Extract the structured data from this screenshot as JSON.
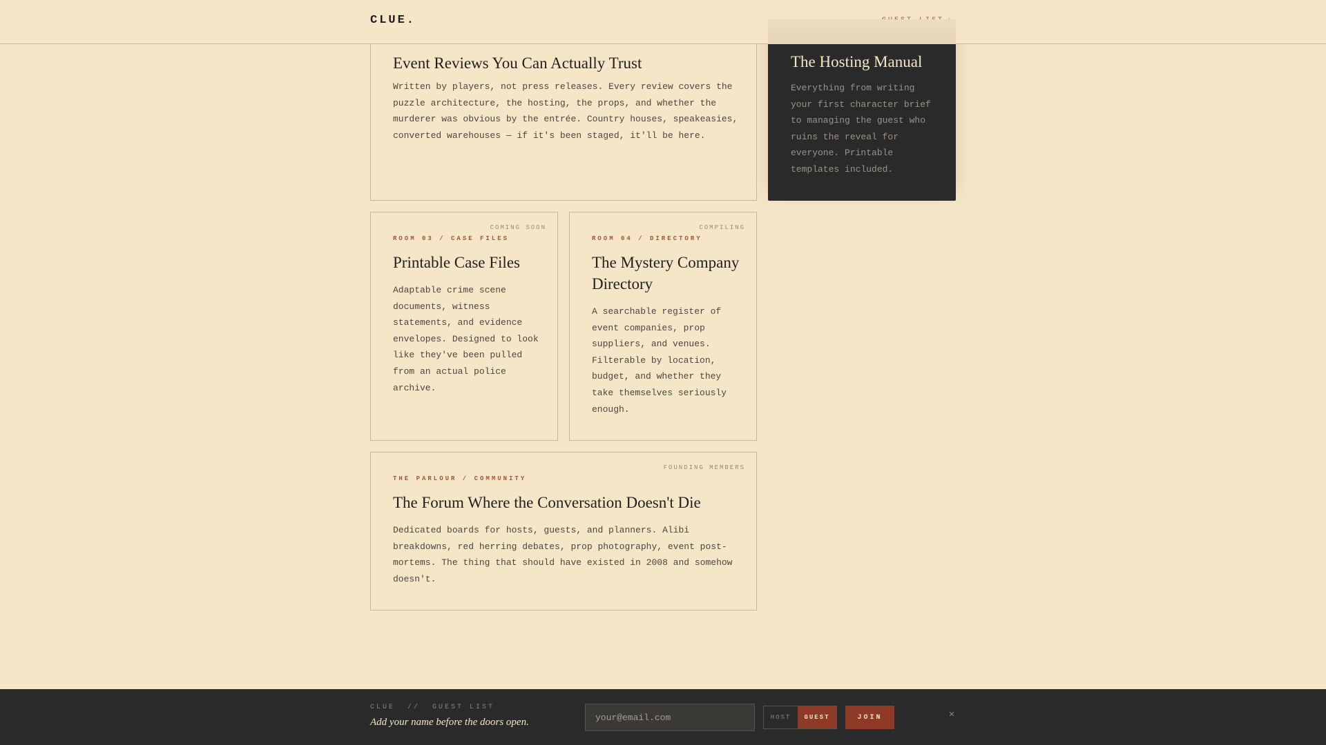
{
  "header": {
    "logo": "CLUE.",
    "guest_list_link": "GUEST LIST",
    "guest_list_arrow": "↓"
  },
  "cards": {
    "reviews": {
      "title": "Event Reviews You Can Actually Trust",
      "body": "Written by players, not press releases. Every review covers the puzzle architecture, the hosting, the props, and whether the murderer was obvious by the entrée. Country houses, speakeasies, converted warehouses — if it's been staged, it'll be here."
    },
    "hosting": {
      "title": "The Hosting Manual",
      "body": "Everything from writing your first character brief to managing the guest who ruins the reveal for everyone. Printable templates included."
    },
    "case_files": {
      "badge": "COMING SOON",
      "label": "ROOM 03 / CASE FILES",
      "title": "Printable Case Files",
      "body": "Adaptable crime scene documents, witness statements, and evidence envelopes. Designed to look like they've been pulled from an actual police archive."
    },
    "directory": {
      "badge": "COMPILING",
      "label": "ROOM 04 / DIRECTORY",
      "title": "The Mystery Company Directory",
      "body": "A searchable register of event companies, prop suppliers, and venues. Filterable by location, budget, and whether they take themselves seriously enough."
    },
    "forum": {
      "badge": "FOUNDING MEMBERS",
      "label": "THE PARLOUR / COMMUNITY",
      "title": "The Forum Where the Conversation Doesn't Die",
      "body": "Dedicated boards for hosts, guests, and planners. Alibi breakdowns, red herring debates, prop photography, event post-mortems. The thing that should have existed in 2008 and somehow doesn't."
    }
  },
  "footer": {
    "kicker": "CLUE  //  GUEST LIST",
    "tagline": "Add your name before the doors open.",
    "email_placeholder": "your@email.com",
    "email_value": "",
    "role_options": [
      "HOST",
      "GUEST"
    ],
    "role_selected": "GUEST",
    "join_label": "JOIN",
    "close_icon": "×"
  },
  "colors": {
    "background": "#f5e6c8",
    "ink": "#2a2a2a",
    "accent": "#8e3a26",
    "label": "#a0523a"
  }
}
